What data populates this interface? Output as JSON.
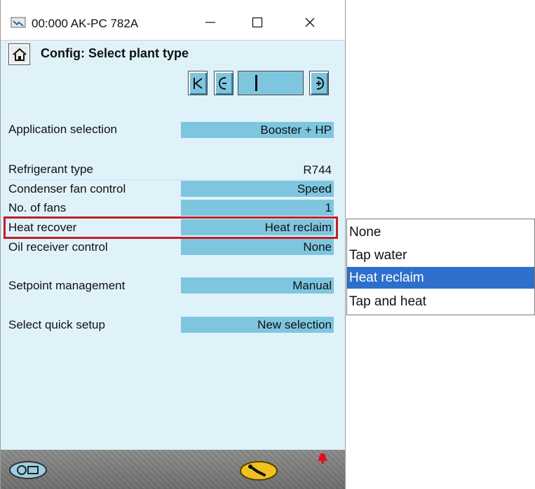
{
  "window": {
    "title": "00:000 AK-PC 782A"
  },
  "page": {
    "title": "Config: Select plant type"
  },
  "settings": [
    {
      "label": "Application selection",
      "value": "Booster + HP"
    },
    {
      "label": "Refrigerant type",
      "value": "R744"
    },
    {
      "label": "Condenser fan control",
      "value": "Speed"
    },
    {
      "label": "No. of fans",
      "value": "1"
    },
    {
      "label": "Heat recover",
      "value": "Heat reclaim"
    },
    {
      "label": "Oil receiver control",
      "value": "None"
    },
    {
      "label": "Setpoint management",
      "value": "Manual"
    },
    {
      "label": "Select quick setup",
      "value": "New selection"
    }
  ],
  "dropdown": {
    "options": [
      "None",
      "Tap water",
      "Heat reclaim",
      "Tap and heat"
    ],
    "selected": "Heat reclaim"
  },
  "icons": {
    "home": "home-icon",
    "first": "first-page-icon",
    "prev": "previous-icon",
    "next": "next-icon",
    "service": "service-tool-icon",
    "alarm": "alarm-bell-icon"
  },
  "colors": {
    "background": "#dff2fa",
    "field": "#7ec6df",
    "highlight_border": "#c0202a",
    "selected": "#2e6fcc",
    "alarm": "#e0101c"
  }
}
